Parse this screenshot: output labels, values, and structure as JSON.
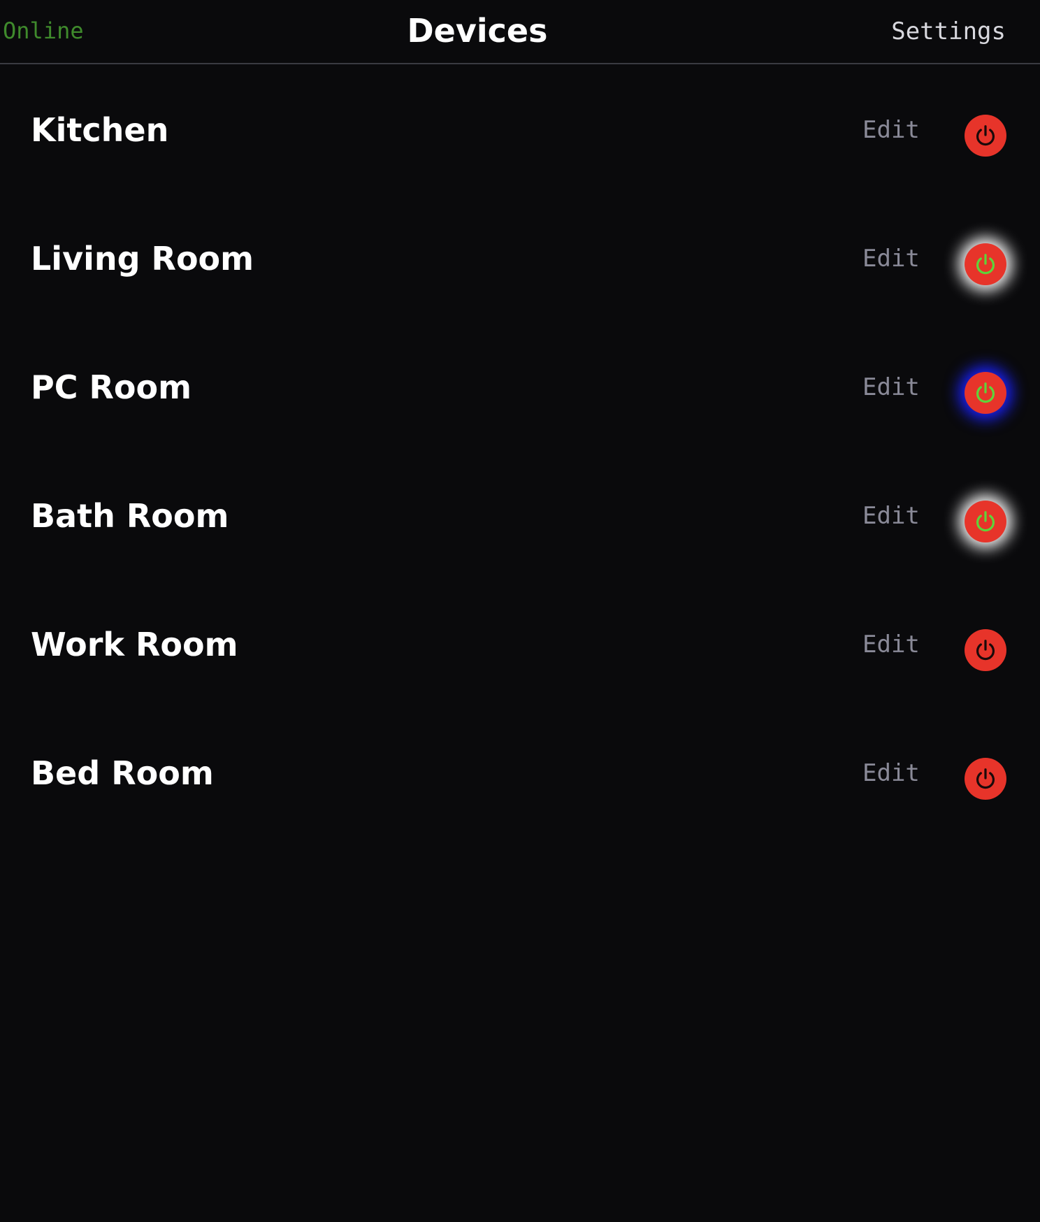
{
  "header": {
    "status_label": "Online",
    "status_color": "#3f8a2c",
    "title": "Devices",
    "settings_label": "Settings"
  },
  "colors": {
    "background": "#0a0a0c",
    "power_button": "#e7342a",
    "icon_on": "#5fd33a",
    "icon_off": "#1a0a0a",
    "edit_text": "#8a8a98"
  },
  "devices": [
    {
      "name": "Kitchen",
      "edit_label": "Edit",
      "power_icon": "power-icon",
      "on": false,
      "glow": "none"
    },
    {
      "name": "Living Room",
      "edit_label": "Edit",
      "power_icon": "power-icon",
      "on": true,
      "glow": "#ffffff"
    },
    {
      "name": "PC Room",
      "edit_label": "Edit",
      "power_icon": "power-icon",
      "on": true,
      "glow": "#1a22ff"
    },
    {
      "name": "Bath Room",
      "edit_label": "Edit",
      "power_icon": "power-icon",
      "on": true,
      "glow": "#ffffff"
    },
    {
      "name": "Work Room",
      "edit_label": "Edit",
      "power_icon": "power-icon",
      "on": false,
      "glow": "none"
    },
    {
      "name": "Bed Room",
      "edit_label": "Edit",
      "power_icon": "power-icon",
      "on": false,
      "glow": "none"
    }
  ]
}
